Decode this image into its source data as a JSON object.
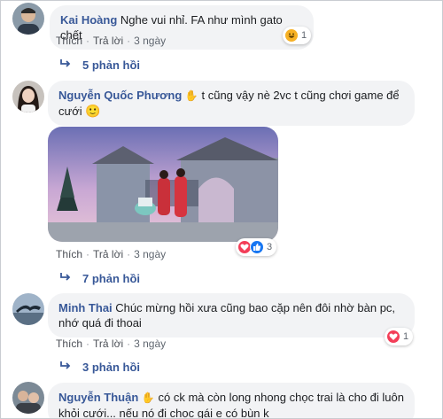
{
  "comments": [
    {
      "name": "Kai Hoàng",
      "text": "Nghe vui nhỉ. FA như mình gato chết",
      "actions": {
        "like": "Thích",
        "reply": "Trả lời",
        "time": "3 ngày"
      },
      "reactions": {
        "icon": "haha-emoji-icon",
        "count": "1"
      },
      "replies_label": "5 phản hồi"
    },
    {
      "name": "Nguyễn Quốc Phương",
      "badge_icon": "hand-wave-icon",
      "text_line1": "t cũng vậy nè 2vc t cũng chơi game để",
      "text_line2": "cưới",
      "emoji": "🙂",
      "actions": {
        "like": "Thích",
        "reply": "Trả lời",
        "time": "3 ngày"
      },
      "reactions": {
        "icons": [
          "love-icon",
          "like-icon"
        ],
        "count": "3"
      },
      "replies_label": "7 phản hồi"
    },
    {
      "name": "Minh Thai",
      "text_line1": "Chúc mừng hồi xưa cũng bao cặp nên đôi nhờ bàn pc,",
      "text_line2": "nhớ quá đi thoai",
      "actions": {
        "like": "Thích",
        "reply": "Trả lời",
        "time": "3 ngày"
      },
      "reactions": {
        "icon": "love-icon",
        "count": "1"
      },
      "replies_label": "3 phản hồi"
    },
    {
      "name": "Nguyễn Thuận",
      "badge_icon": "hand-wave-icon",
      "text_line1": "có ck mà còn long nhong chọc trai là cho đi luôn",
      "text_line2": "khỏi cưới... nếu nó đi chọc gái e có bùn k"
    }
  ],
  "colors": {
    "name": "#385898",
    "bubble": "#f2f3f5",
    "love": "#f33e58",
    "like": "#1877f2",
    "haha": "#f7b125"
  }
}
